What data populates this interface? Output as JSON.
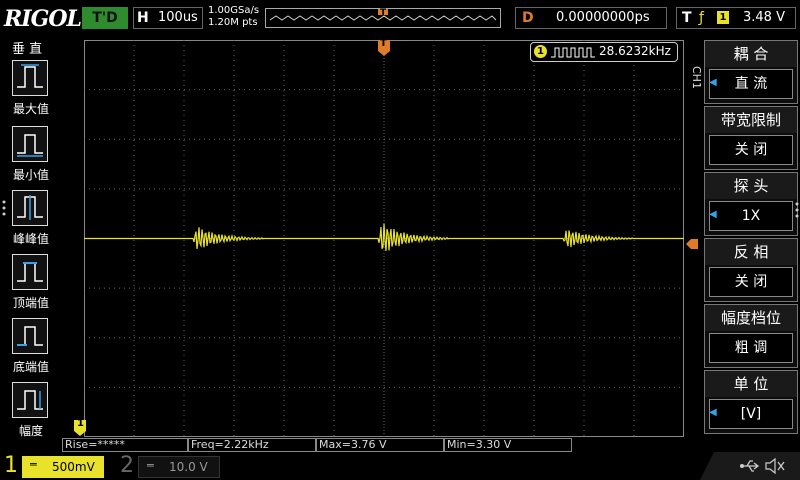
{
  "topbar": {
    "logo": "RIGOL",
    "trigger_status": "T'D",
    "h_label": "H",
    "timebase": "100us",
    "sample_rate": "1.00GSa/s",
    "memory_depth": "1.20M pts",
    "trigger_pos_marker": "T",
    "d_label": "D",
    "delay": "0.00000000ps",
    "t_label": "T",
    "trigger_edge": "ƒ",
    "trigger_channel": "1",
    "trigger_level": "3.48 V"
  },
  "left_panel": {
    "title": "垂 直",
    "items": [
      {
        "label": "最大值",
        "icon": "max-wave-icon"
      },
      {
        "label": "最小值",
        "icon": "min-wave-icon"
      },
      {
        "label": "峰峰值",
        "icon": "peak-peak-wave-icon"
      },
      {
        "label": "顶端值",
        "icon": "top-wave-icon"
      },
      {
        "label": "底端值",
        "icon": "base-wave-icon"
      },
      {
        "label": "幅度",
        "icon": "amplitude-wave-icon"
      }
    ]
  },
  "screen": {
    "freq_counter_channel": "1",
    "freq_counter": "28.6232kHz",
    "trigger_marker": "T",
    "ground_marker": "1"
  },
  "right_panel": {
    "channel_label": "CH1",
    "items": [
      {
        "head": "耦 合",
        "value": "直 流",
        "arrow": true
      },
      {
        "head": "带宽限制",
        "value": "关 闭",
        "arrow": false
      },
      {
        "head": "探 头",
        "value": "1X",
        "arrow": true
      },
      {
        "head": "反 相",
        "value": "关 闭",
        "arrow": false
      },
      {
        "head": "幅度档位",
        "value": "粗 调",
        "arrow": false
      },
      {
        "head": "单 位",
        "value": "[V]",
        "arrow": true
      }
    ]
  },
  "measurements": [
    "Rise=*****",
    "Freq=2.22kHz",
    "Max=3.76 V",
    "Min=3.30 V"
  ],
  "channels": [
    {
      "number": "1",
      "coupling": "═",
      "scale": "500mV"
    },
    {
      "number": "2",
      "coupling": "═",
      "scale": "10.0 V"
    }
  ],
  "status_icons": [
    "usb-icon",
    "speaker-muted-icon"
  ],
  "colors": {
    "ch1": "#e8e32a",
    "trigger": "#e07b2a",
    "accent_blue": "#3aa0e8",
    "trig_status_bg": "#2e8b2e"
  },
  "waveform": {
    "baseline_div": 0,
    "bursts": [
      {
        "center_div": -3.7,
        "amp_div": 0.3
      },
      {
        "center_div": 0.0,
        "amp_div": 0.4
      },
      {
        "center_div": 3.7,
        "amp_div": 0.25
      }
    ]
  }
}
